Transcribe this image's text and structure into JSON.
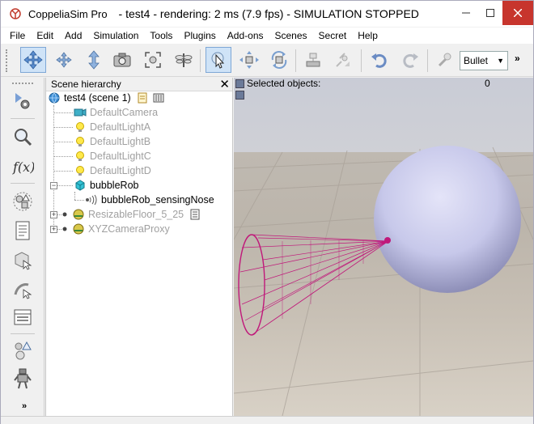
{
  "window": {
    "app_name": "CoppeliaSim Pro",
    "title": "- test4 - rendering: 2 ms (7.9 fps) - SIMULATION STOPPED"
  },
  "menu": [
    "File",
    "Edit",
    "Add",
    "Simulation",
    "Tools",
    "Plugins",
    "Add-ons",
    "Scenes",
    "Secret",
    "Help"
  ],
  "toolbar": {
    "engine_selected": "Bullet",
    "overflow": "»"
  },
  "hierarchy": {
    "title": "Scene hierarchy",
    "root": "test4 (scene 1)",
    "items": [
      {
        "label": "DefaultCamera",
        "icon": "camera-icon"
      },
      {
        "label": "DefaultLightA",
        "icon": "light-icon"
      },
      {
        "label": "DefaultLightB",
        "icon": "light-icon"
      },
      {
        "label": "DefaultLightC",
        "icon": "light-icon"
      },
      {
        "label": "DefaultLightD",
        "icon": "light-icon"
      },
      {
        "label": "bubbleRob",
        "icon": "shape-icon"
      },
      {
        "label": "bubbleRob_sensingNose",
        "icon": "proximity-sensor-icon"
      },
      {
        "label": "ResizableFloor_5_25",
        "icon": "floor-icon"
      },
      {
        "label": "XYZCameraProxy",
        "icon": "floor-icon"
      }
    ]
  },
  "viewport": {
    "selected_label": "Selected objects:",
    "selected_count": "0"
  },
  "colors": {
    "sphere": "#c7c8ea",
    "cone": "#c0187a",
    "close_button": "#c7352d",
    "active_tool": "#cfe3f7"
  }
}
